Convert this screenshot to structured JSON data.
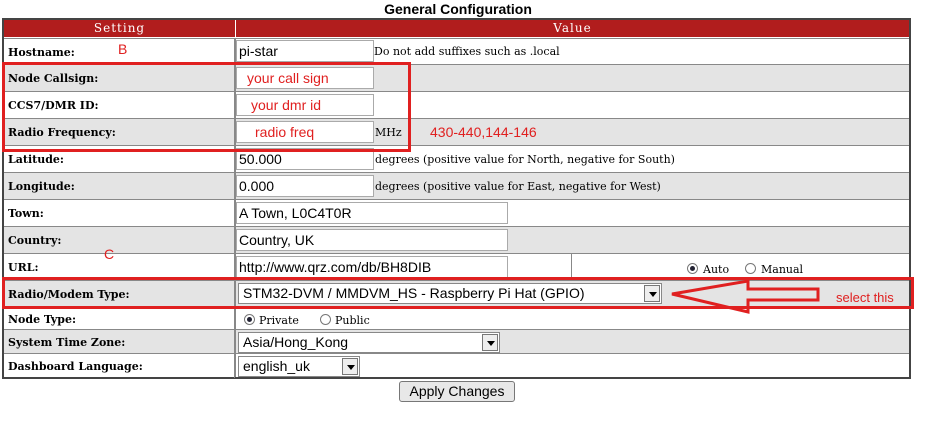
{
  "title": "General Configuration",
  "header": {
    "setting": "Setting",
    "value": "Value"
  },
  "rows": {
    "hostname": {
      "label": "Hostname:",
      "value": "pi-star",
      "note": "Do not add suffixes such as .local"
    },
    "callsign": {
      "label": "Node Callsign:",
      "value": "your call sign"
    },
    "dmrid": {
      "label": "CCS7/DMR ID:",
      "value": "your dmr id"
    },
    "freq": {
      "label": "Radio Frequency:",
      "value": "radio freq",
      "unit": "MHz"
    },
    "latitude": {
      "label": "Latitude:",
      "value": "50.000",
      "note": "degrees (positive value for North, negative for South)"
    },
    "longitude": {
      "label": "Longitude:",
      "value": "0.000",
      "note": "degrees (positive value for East, negative for West)"
    },
    "town": {
      "label": "Town:",
      "value": "A Town, L0C4T0R"
    },
    "country": {
      "label": "Country:",
      "value": "Country, UK"
    },
    "url": {
      "label": "URL:",
      "value": "http://www.qrz.com/db/BH8DIB",
      "opt_auto": "Auto",
      "opt_manual": "Manual"
    },
    "modem": {
      "label": "Radio/Modem Type:",
      "value": "STM32-DVM / MMDVM_HS - Raspberry Pi Hat (GPIO)"
    },
    "nodetype": {
      "label": "Node Type:",
      "opt_private": "Private",
      "opt_public": "Public"
    },
    "timezone": {
      "label": "System Time Zone:",
      "value": "Asia/Hong_Kong"
    },
    "language": {
      "label": "Dashboard Language:",
      "value": "english_uk"
    }
  },
  "apply_label": "Apply Changes",
  "annotations": {
    "b": "B",
    "c": "C",
    "freq_range": "430-440,144-146",
    "select_this": "select this",
    "color": "#e02020"
  }
}
